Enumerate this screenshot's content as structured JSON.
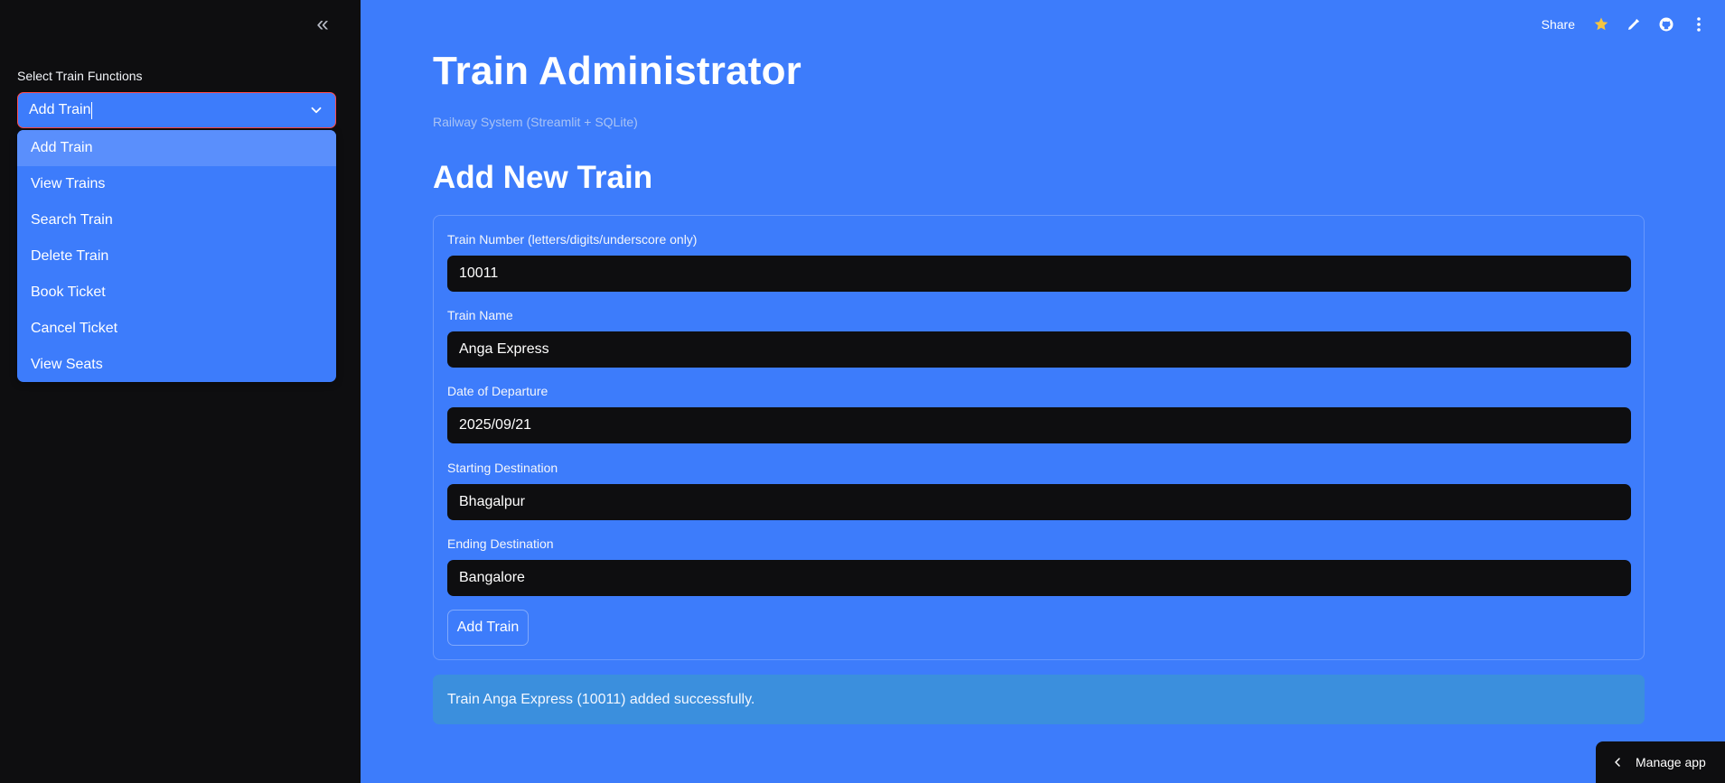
{
  "sidebar": {
    "collapse_glyph": "«",
    "select_label": "Select Train Functions",
    "select_value": "Add Train",
    "options": [
      {
        "label": "Add Train"
      },
      {
        "label": "View Trains"
      },
      {
        "label": "Search Train"
      },
      {
        "label": "Delete Train"
      },
      {
        "label": "Book Ticket"
      },
      {
        "label": "Cancel Ticket"
      },
      {
        "label": "View Seats"
      }
    ]
  },
  "header": {
    "title": "Train Administrator",
    "subtitle": "Railway System (Streamlit + SQLite)"
  },
  "toolbar": {
    "share_label": "Share",
    "icons": [
      "star-icon",
      "pencil-icon",
      "github-icon",
      "more-vertical-icon"
    ]
  },
  "form": {
    "title": "Add New Train",
    "fields": [
      {
        "label": "Train Number (letters/digits/underscore only)",
        "value": "10011"
      },
      {
        "label": "Train Name",
        "value": "Anga Express"
      },
      {
        "label": "Date of Departure",
        "value": "2025/09/21"
      },
      {
        "label": "Starting Destination",
        "value": "Bhagalpur"
      },
      {
        "label": "Ending Destination",
        "value": "Bangalore"
      }
    ],
    "submit_label": "Add Train"
  },
  "status": {
    "message": "Train Anga Express (10011) added successfully."
  },
  "footer": {
    "manage_label": "Manage app"
  },
  "colors": {
    "background": "#3d7cfb",
    "sidebar": "#0e0e10",
    "focus_border": "#ff4b4b",
    "star": "#f5c542",
    "success_bg": "#3b8fdd"
  }
}
